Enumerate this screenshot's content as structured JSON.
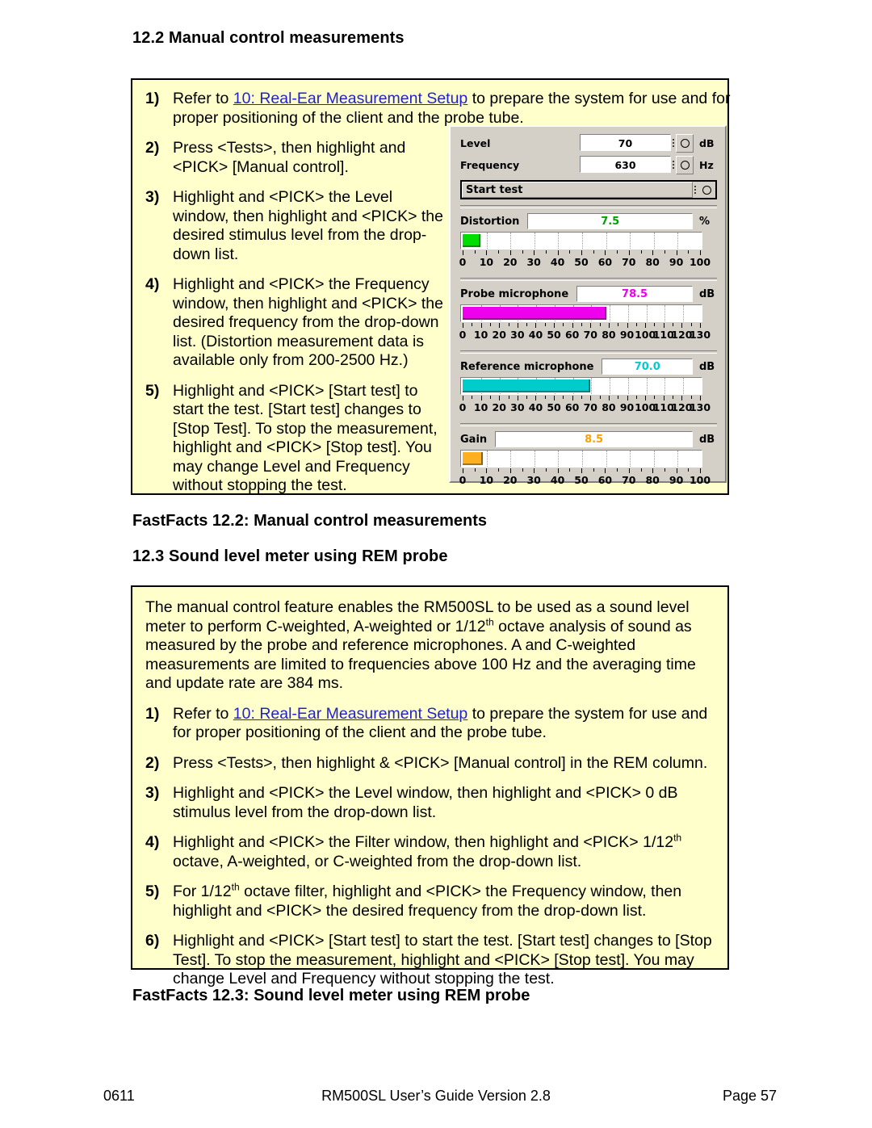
{
  "headings": {
    "s122": "12.2  Manual control measurements",
    "s123": "12.3  Sound level meter using REM probe"
  },
  "fastfacts": {
    "ff122": "FastFacts 12.2: Manual control measurements",
    "ff123": "FastFacts 12.3: Sound level meter using REM probe"
  },
  "box1": {
    "steps": [
      {
        "num": "1)",
        "pre": "Refer to ",
        "link": "10: Real-Ear Measurement Setup",
        "post": " to prepare the system for use and for proper positioning of the client and the probe tube."
      },
      {
        "num": "2)",
        "text": "Press <Tests>, then highlight and <PICK> [Manual control]."
      },
      {
        "num": "3)",
        "text": "Highlight and <PICK> the Level window, then highlight and <PICK> the desired stimulus level from the drop-down list."
      },
      {
        "num": "4)",
        "text": "Highlight and <PICK> the Frequency window, then highlight and <PICK> the desired frequency from the drop-down list. (Distortion measurement data is available only from 200-2500 Hz.)"
      },
      {
        "num": "5)",
        "text": "Highlight and <PICK> [Start test] to start the test. [Start test] changes to [Stop Test]. To stop the measurement, highlight and <PICK> [Stop test]. You may change Level and Frequency without stopping the test."
      }
    ]
  },
  "box2": {
    "intro": "The manual control feature enables the RM500SL to be used as a sound level meter to perform C-weighted, A-weighted or 1/12|th| octave analysis of sound as measured by the probe and reference microphones. A and C-weighted measurements are limited to frequencies above 100 Hz and the averaging time and update rate are 384 ms.",
    "steps": [
      {
        "num": "1)",
        "pre": "Refer to ",
        "link": "10: Real-Ear Measurement Setup",
        "post": " to prepare the system for use and for proper positioning of the client and the probe tube."
      },
      {
        "num": "2)",
        "text": "Press <Tests>, then highlight & <PICK> [Manual control] in the REM column."
      },
      {
        "num": "3)",
        "text": "Highlight and <PICK> the Level window, then highlight and <PICK> 0 dB stimulus level from the drop-down list."
      },
      {
        "num": "4)",
        "text": "Highlight and <PICK> the Filter window, then highlight and <PICK> 1/12|th| octave, A-weighted, or C-weighted from the drop-down list."
      },
      {
        "num": "5)",
        "text": "For 1/12|th| octave filter, highlight and <PICK> the Frequency window, then highlight and <PICK> the desired frequency from the drop-down list."
      },
      {
        "num": "6)",
        "text": "Highlight and <PICK> [Start test] to start the test. [Start test] changes to [Stop Test]. To stop the measurement, highlight and <PICK> [Stop test]. You may change Level and Frequency without stopping the test."
      }
    ]
  },
  "panel": {
    "level": {
      "label": "Level",
      "value": "70",
      "unit": "dB"
    },
    "frequency": {
      "label": "Frequency",
      "value": "630",
      "unit": "Hz"
    },
    "start_test": {
      "label": "Start test"
    },
    "meters": [
      {
        "name": "distortion",
        "label": "Distortion",
        "value": "7.5",
        "unit": "%",
        "value_color": "#00a000",
        "fill_color": "#00dd00",
        "max": 100,
        "ticks": [
          0,
          10,
          20,
          30,
          40,
          50,
          60,
          70,
          80,
          90,
          100
        ]
      },
      {
        "name": "probe-microphone",
        "label": "Probe microphone",
        "value": "78.5",
        "unit": "dB",
        "value_color": "#ee00ee",
        "fill_color": "#ee00ee",
        "max": 130,
        "ticks": [
          0,
          10,
          20,
          30,
          40,
          50,
          60,
          70,
          80,
          90,
          100,
          110,
          120,
          130
        ]
      },
      {
        "name": "reference-microphone",
        "label": "Reference microphone",
        "value": "70.0",
        "unit": "dB",
        "value_color": "#00cccc",
        "fill_color": "#00cccc",
        "max": 130,
        "ticks": [
          0,
          10,
          20,
          30,
          40,
          50,
          60,
          70,
          80,
          90,
          100,
          110,
          120,
          130
        ]
      },
      {
        "name": "gain",
        "label": "Gain",
        "value": "8.5",
        "unit": "dB",
        "value_color": "#ffa000",
        "fill_color": "#ffb020",
        "max": 100,
        "ticks": [
          0,
          10,
          20,
          30,
          40,
          50,
          60,
          70,
          80,
          90,
          100
        ]
      }
    ]
  },
  "footer": {
    "left": "0611",
    "middle": "RM500SL User’s Guide Version 2.8",
    "right": "Page 57"
  }
}
